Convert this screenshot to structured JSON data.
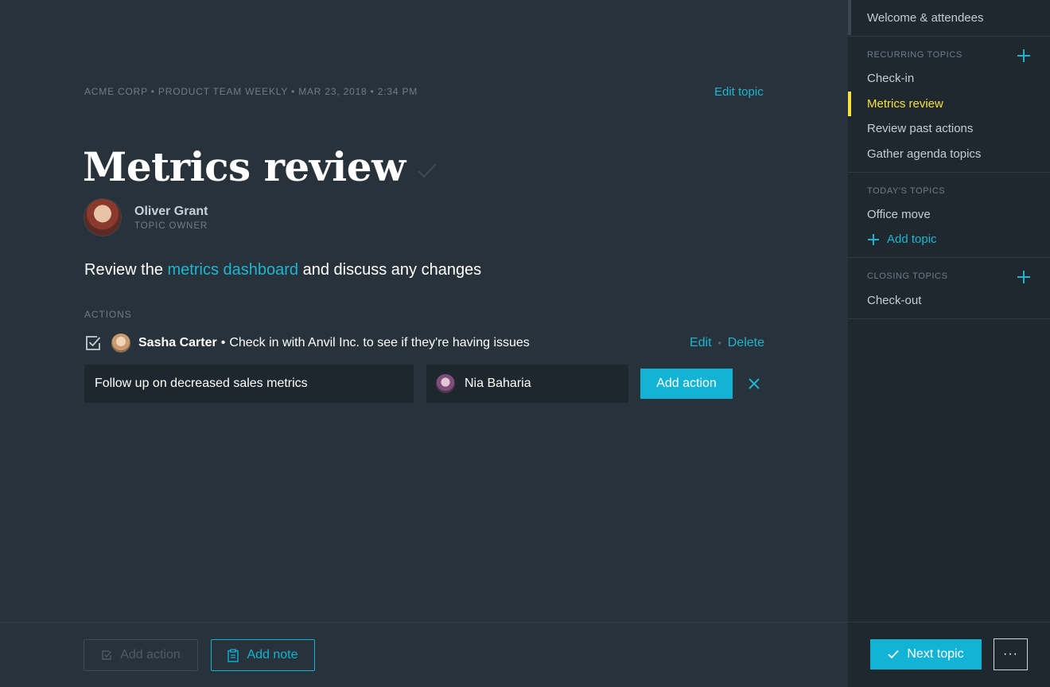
{
  "meeting": {
    "breadcrumb": "ACME CORP • PRODUCT TEAM WEEKLY • MAR 23, 2018 • 2:34 PM",
    "edit_topic_label": "Edit topic"
  },
  "topic": {
    "title": "Metrics review",
    "owner_name": "Oliver Grant",
    "owner_role": "TOPIC OWNER",
    "description_before": "Review the",
    "description_link": "metrics dashboard",
    "description_after": "and discuss any changes"
  },
  "actions": {
    "label": "ACTIONS",
    "items": [
      {
        "owner": "Sasha Carter",
        "separator": "•",
        "text": "Check in with Anvil Inc. to see if they're having issues",
        "edit_label": "Edit",
        "delete_label": "Delete",
        "dot": "•"
      }
    ],
    "form": {
      "input_value": "Follow up on decreased sales metrics",
      "assignee": "Nia Baharia",
      "submit_label": "Add action"
    }
  },
  "footer": {
    "add_action_label": "Add action",
    "add_note_label": "Add note"
  },
  "sidebar": {
    "welcome": "Welcome & attendees",
    "recurring_heading": "RECURRING TOPICS",
    "recurring": [
      "Check-in",
      "Metrics review",
      "Review past actions",
      "Gather agenda topics"
    ],
    "active_topic": "Metrics review",
    "todays_heading": "TODAY'S TOPICS",
    "todays": [
      "Office move"
    ],
    "add_topic_label": "Add topic",
    "closing_heading": "CLOSING TOPICS",
    "closing": [
      "Check-out"
    ],
    "next_topic_label": "Next topic",
    "more_label": "···"
  },
  "colors": {
    "accent": "#12b3d4",
    "active_highlight": "#f7e13b",
    "background": "#27323b",
    "sidebar_background": "#1f282f"
  }
}
